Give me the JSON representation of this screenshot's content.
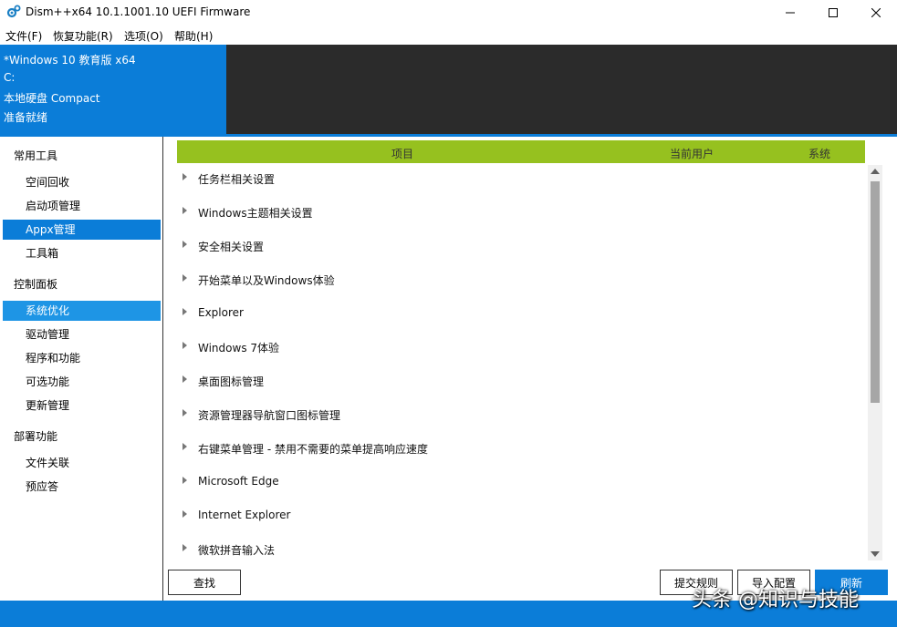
{
  "window": {
    "title": "Dism++x64 10.1.1001.10 UEFI Firmware"
  },
  "menu": {
    "items": [
      "文件(F)",
      "恢复功能(R)",
      "选项(O)",
      "帮助(H)"
    ]
  },
  "info": {
    "lines": [
      "*Windows 10 教育版 x64",
      "C:",
      "本地硬盘 Compact",
      "准备就绪"
    ]
  },
  "sidebar": {
    "groups": [
      {
        "title": "常用工具",
        "items": [
          "空间回收",
          "启动项管理",
          "Appx管理",
          "工具箱"
        ]
      },
      {
        "title": "控制面板",
        "items": [
          "系统优化",
          "驱动管理",
          "程序和功能",
          "可选功能",
          "更新管理"
        ]
      },
      {
        "title": "部署功能",
        "items": [
          "文件关联",
          "预应答"
        ]
      }
    ]
  },
  "list": {
    "columns": [
      "项目",
      "当前用户",
      "系统"
    ],
    "rows": [
      "任务栏相关设置",
      "Windows主题相关设置",
      "安全相关设置",
      "开始菜单以及Windows体验",
      "Explorer",
      "Windows 7体验",
      "桌面图标管理",
      "资源管理器导航窗口图标管理",
      "右键菜单管理 - 禁用不需要的菜单提高响应速度",
      "Microsoft Edge",
      "Internet Explorer",
      "微软拼音输入法"
    ]
  },
  "buttons": {
    "find": "查找",
    "submit_rule": "提交规则",
    "import_config": "导入配置",
    "refresh": "刷新"
  },
  "watermark": "头条 @知识与技能",
  "colors": {
    "accent_blue": "#0b7dd8",
    "header_green": "#96c11f",
    "dark_panel": "#2b2b2b"
  },
  "icons": {
    "app": "gears-icon",
    "minimize": "minimize-icon",
    "maximize": "maximize-icon",
    "close": "close-icon"
  }
}
